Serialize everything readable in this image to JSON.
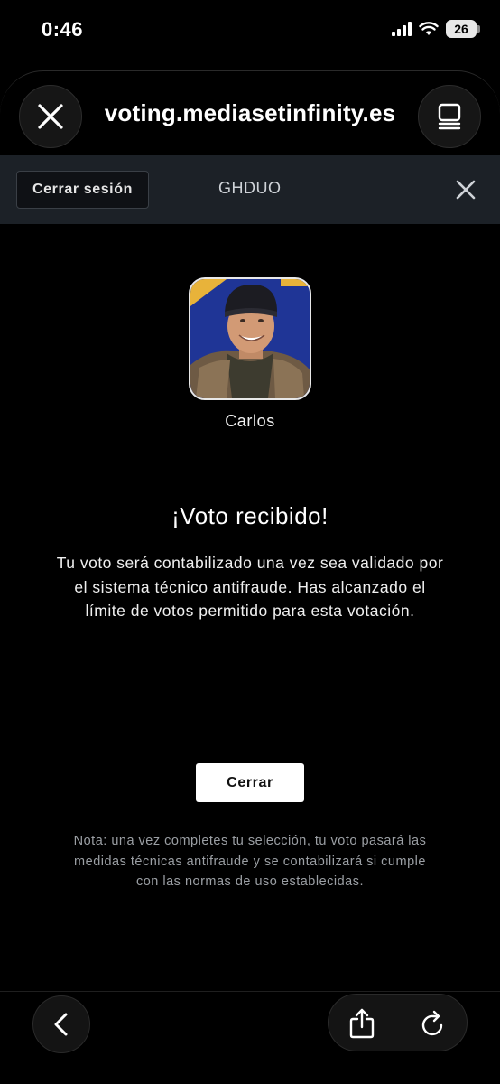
{
  "status_bar": {
    "time": "0:46",
    "battery": "26"
  },
  "browser": {
    "url": "voting.mediasetinfinity.es",
    "close_icon": "close-icon",
    "reader_icon": "tab-overview-icon"
  },
  "site_header": {
    "logout_label": "Cerrar sesión",
    "user_code": "GHDUO"
  },
  "candidate": {
    "name": "Carlos"
  },
  "confirmation": {
    "headline": "¡Voto recibido!",
    "message": "Tu voto será contabilizado una vez sea validado por el sistema técnico antifraude. Has alcanzado el límite de votos permitido para esta votación.",
    "close_label": "Cerrar",
    "note": "Nota: una vez completes tu selección, tu voto pasará las medidas técnicas antifraude y se contabilizará si cumple con las normas de uso establecidas."
  },
  "toolbar": {
    "back_icon": "chevron-left-icon",
    "share_icon": "share-icon",
    "reload_icon": "reload-icon"
  },
  "colors": {
    "background": "#000000",
    "site_bar": "#1c2127",
    "note_text": "#9b9fa4"
  }
}
